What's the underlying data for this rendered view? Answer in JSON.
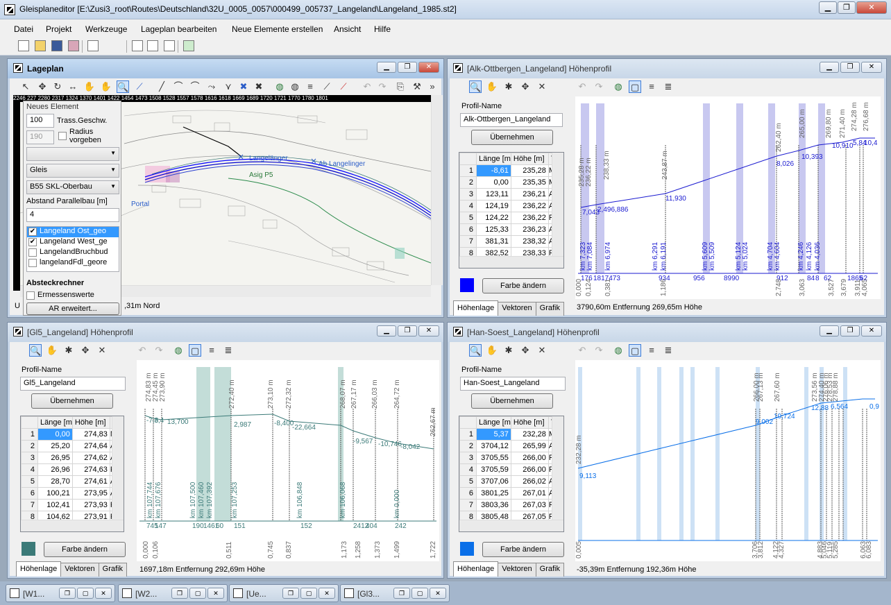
{
  "app": {
    "title": "Gleisplaneditor [E:\\Zusi3_root\\Routes\\Deutschland\\32U_0005_0057\\000499_005737_Langeland\\Langeland_1985.st2]"
  },
  "menu": [
    "Datei",
    "Projekt",
    "Werkzeuge",
    "Lageplan bearbeiten",
    "Neue Elemente erstellen",
    "Ansicht",
    "Hilfe"
  ],
  "lageplan": {
    "title": "Lageplan",
    "ruler_top": "2246 227 2280 2317 1324 1370 1401 1422 1454 1473 1508 1528 1557 1578 1616 1618 1669 1689 1720 1721 1770 1780 1801",
    "new_element": {
      "heading": "Neues Element",
      "speed": "100",
      "speed_label": "Trass.Geschw.",
      "radius": "190",
      "radius_label": "Radius vorgeben",
      "combo1": "",
      "combo2": "Gleis",
      "combo3": "B55 SKL-Oberbau",
      "parallel_label": "Abstand Parallelbau [m]",
      "parallel": "4",
      "layers": [
        {
          "label": "Langeland Ost_geo",
          "checked": "✔",
          "selected": true
        },
        {
          "label": "Langeland West_ge",
          "checked": "✔",
          "selected": false
        },
        {
          "label": "LangelandBruchbud",
          "checked": "",
          "selected": false
        },
        {
          "label": "langelandFdl_geore",
          "checked": "",
          "selected": false
        }
      ],
      "absteck_heading": "Absteckrechner",
      "ermessen_label": "Ermessenswerte",
      "ar_button": "AR erweitert..."
    },
    "map_labels": [
      "Asig P5",
      "Langelänger",
      "Ab Langelinger",
      "Portal"
    ],
    "status_left": "U",
    "status_right": ",31m Nord"
  },
  "alk": {
    "title": "[Alk-Ottbergen_Langeland] Höhenprofil",
    "profile_name_label": "Profil-Name",
    "profile_name": "Alk-Ottbergen_Langeland",
    "apply": "Übernehmen",
    "headers": [
      "",
      "Länge [m",
      "Höhe [m]",
      "T"
    ],
    "rows": [
      [
        "1",
        "-8,61",
        "235,28",
        "M"
      ],
      [
        "2",
        "0,00",
        "235,35",
        "M"
      ],
      [
        "3",
        "123,11",
        "236,21",
        "A"
      ],
      [
        "4",
        "124,19",
        "236,22",
        "A"
      ],
      [
        "5",
        "124,22",
        "236,22",
        "F"
      ],
      [
        "6",
        "125,33",
        "236,23",
        "A"
      ],
      [
        "7",
        "381,31",
        "238,32",
        "A"
      ],
      [
        "8",
        "382,52",
        "238,33",
        "F"
      ]
    ],
    "color": "#0000ff",
    "color_button": "Farbe ändern",
    "tabs": [
      "Höhenlage",
      "Vektoren",
      "Grafik"
    ],
    "status": "3790,60m Entfernung  269,65m Höhe",
    "top_labels": [
      "235,28 m",
      "236,22 m",
      "238,33 m",
      "243,87 m",
      "262,40 m",
      "265,00 m",
      "269,80 m",
      "271,40 m",
      "274,28 m",
      "276,68 m"
    ],
    "grad_labels": [
      "7,043",
      "2,496,886",
      "11,930",
      "8,026",
      "10,393",
      "10,910",
      "5,84",
      "10,4"
    ],
    "km_labels": [
      "km 7,323",
      "km 7,084",
      "km 6,974",
      "km 6,291",
      "km 6,191",
      "km 5,609",
      "km 5,509",
      "km 5,124",
      "km 5,024",
      "km 4,704",
      "km 4,604",
      "km 4,246",
      "km 4,126",
      "km 4,036"
    ],
    "bottom_labels": [
      "176",
      "1817473",
      "934",
      "956",
      "8990",
      "912",
      "84",
      "8",
      "62",
      "1865",
      "62"
    ],
    "dist_labels": [
      "0,000",
      "0,124",
      "0,381",
      "1,186",
      "2,748",
      "3,063",
      "3,527",
      "3,679",
      "3,911",
      "4,065"
    ]
  },
  "gl5": {
    "title": "[Gl5_Langeland] Höhenprofil",
    "profile_name_label": "Profil-Name",
    "profile_name": "Gl5_Langeland",
    "apply": "Übernehmen",
    "headers": [
      "",
      "Länge [m",
      "Höhe [m]",
      "T"
    ],
    "rows": [
      [
        "1",
        "0,00",
        "274,83",
        "M"
      ],
      [
        "2",
        "25,20",
        "274,64",
        "A"
      ],
      [
        "3",
        "26,95",
        "274,62",
        "A"
      ],
      [
        "4",
        "26,96",
        "274,63",
        "F"
      ],
      [
        "5",
        "28,70",
        "274,61",
        "A"
      ],
      [
        "6",
        "100,21",
        "273,95",
        "A"
      ],
      [
        "7",
        "102,41",
        "273,93",
        "F"
      ],
      [
        "8",
        "104,62",
        "273,91",
        "F"
      ]
    ],
    "color": "#3b7a78",
    "color_button": "Farbe ändern",
    "tabs": [
      "Höhenlage",
      "Vektoren",
      "Grafik"
    ],
    "status": "1697,18m Entfernung  292,69m Höhe",
    "top_labels": [
      "274,83 m",
      "274,45 m",
      "273,90 m",
      "272,40 m",
      "273,10 m",
      "272,32 m",
      "268,07 m",
      "267,17 m",
      "266,03 m",
      "264,72 m",
      "262,67 m"
    ],
    "grad_labels": [
      "-7,6",
      "-3,4",
      "13,700",
      "2,987",
      "-8,400",
      "-22,664",
      "-9,567",
      "-10,746",
      "-8,042"
    ],
    "km_labels": [
      "km 107,744",
      "km 107,676",
      "km 107,500",
      "km 107,460",
      "km 107,392",
      "km 107,253",
      "km 106,848",
      "km 106,068",
      "km 0,000"
    ],
    "bottom_labels": [
      "745",
      "147",
      "190",
      "1461",
      "60",
      "151",
      "152",
      "2412",
      "404",
      "242"
    ],
    "dist_labels": [
      "0,000",
      "0,106",
      "0,511",
      "0,745",
      "0,837",
      "1,173",
      "1,258",
      "1,373",
      "1,499",
      "1,722"
    ]
  },
  "han": {
    "title": "[Han-Soest_Langeland] Höhenprofil",
    "profile_name_label": "Profil-Name",
    "profile_name": "Han-Soest_Langeland",
    "apply": "Übernehmen",
    "headers": [
      "",
      "Länge [m",
      "Höhe [m]",
      "T"
    ],
    "rows": [
      [
        "1",
        "5,37",
        "232,28",
        "M"
      ],
      [
        "2",
        "3704,12",
        "265,99",
        "A"
      ],
      [
        "3",
        "3705,55",
        "266,00",
        "F"
      ],
      [
        "4",
        "3705,59",
        "266,00",
        "F"
      ],
      [
        "5",
        "3707,06",
        "266,02",
        "A"
      ],
      [
        "6",
        "3801,25",
        "267,01",
        "A"
      ],
      [
        "7",
        "3803,36",
        "267,03",
        "F"
      ],
      [
        "8",
        "3805,48",
        "267,05",
        "F"
      ]
    ],
    "color": "#0a6fe8",
    "color_button": "Farbe ändern",
    "tabs": [
      "Höhenlage",
      "Vektoren",
      "Grafik"
    ],
    "status": "-35,39m Entfernung  192,36m Höhe",
    "top_labels": [
      "232,28 m",
      "266,00 m",
      "267,13 m",
      "267,60 m",
      "273,56 m",
      "274,40 m",
      "276,06 m",
      "278,53 m",
      "278,88 m"
    ],
    "grad_labels": [
      "9,113",
      "9,002",
      "10,724",
      "12,88",
      "6,564",
      "0,9"
    ],
    "dist_labels": [
      "0,005",
      "3,706",
      "3,812",
      "4,122",
      "4,327",
      "4,883",
      "5,046",
      "5,119",
      "5,285",
      "6,063",
      "6,083"
    ]
  },
  "minimized": [
    {
      "label": "[W1..."
    },
    {
      "label": "[W2..."
    },
    {
      "label": "[Ue..."
    },
    {
      "label": "[Gl3..."
    }
  ]
}
